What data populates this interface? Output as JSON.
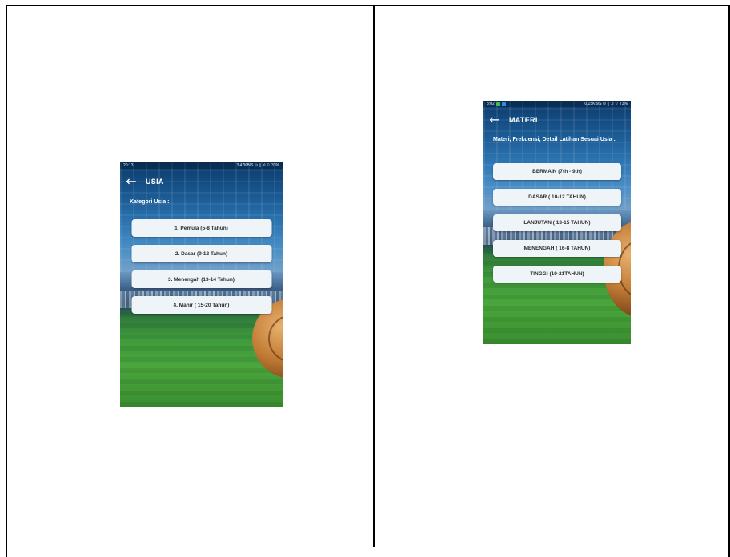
{
  "screen_usia": {
    "status": {
      "time": "20:13",
      "right": "3,47KB/S ⊙ ▯ .ıl ⌔ 33%"
    },
    "title": "USIA",
    "subtitle": "Kategori Usia :",
    "buttons": [
      {
        "label": "1. Pemula (5-8 Tahun)"
      },
      {
        "label": "2. Dasar (9-12 Tahun)"
      },
      {
        "label": "3. Menengah (13-14 Tahun)"
      },
      {
        "label": "4. Mahir ( 15-20 Tahun)"
      }
    ]
  },
  "screen_materi": {
    "status": {
      "time": "8:02",
      "right": "0,15KB/S ⊙ ▯ .ıl ⌔ 73%"
    },
    "title": "MATERI",
    "subtitle": "Materi, Frekuensi, Detail Latihan Sesuai Usia :",
    "buttons": [
      {
        "label": "BERMAIN (7th - 9th)"
      },
      {
        "label": "DASAR ( 10-12 TAHUN)"
      },
      {
        "label": "LANJUTAN ( 13-15 TAHUN)"
      },
      {
        "label": "MENENGAH ( 16-8 TAHUN)"
      },
      {
        "label": "TINGGI (19-21TAHUN)"
      }
    ]
  },
  "colors": {
    "button_bg": "#eef4f8",
    "button_text": "#2b2b2b",
    "sky": "#2f78b5",
    "grass": "#4aa63c"
  },
  "icons": {
    "back": "arrow-left-icon"
  }
}
